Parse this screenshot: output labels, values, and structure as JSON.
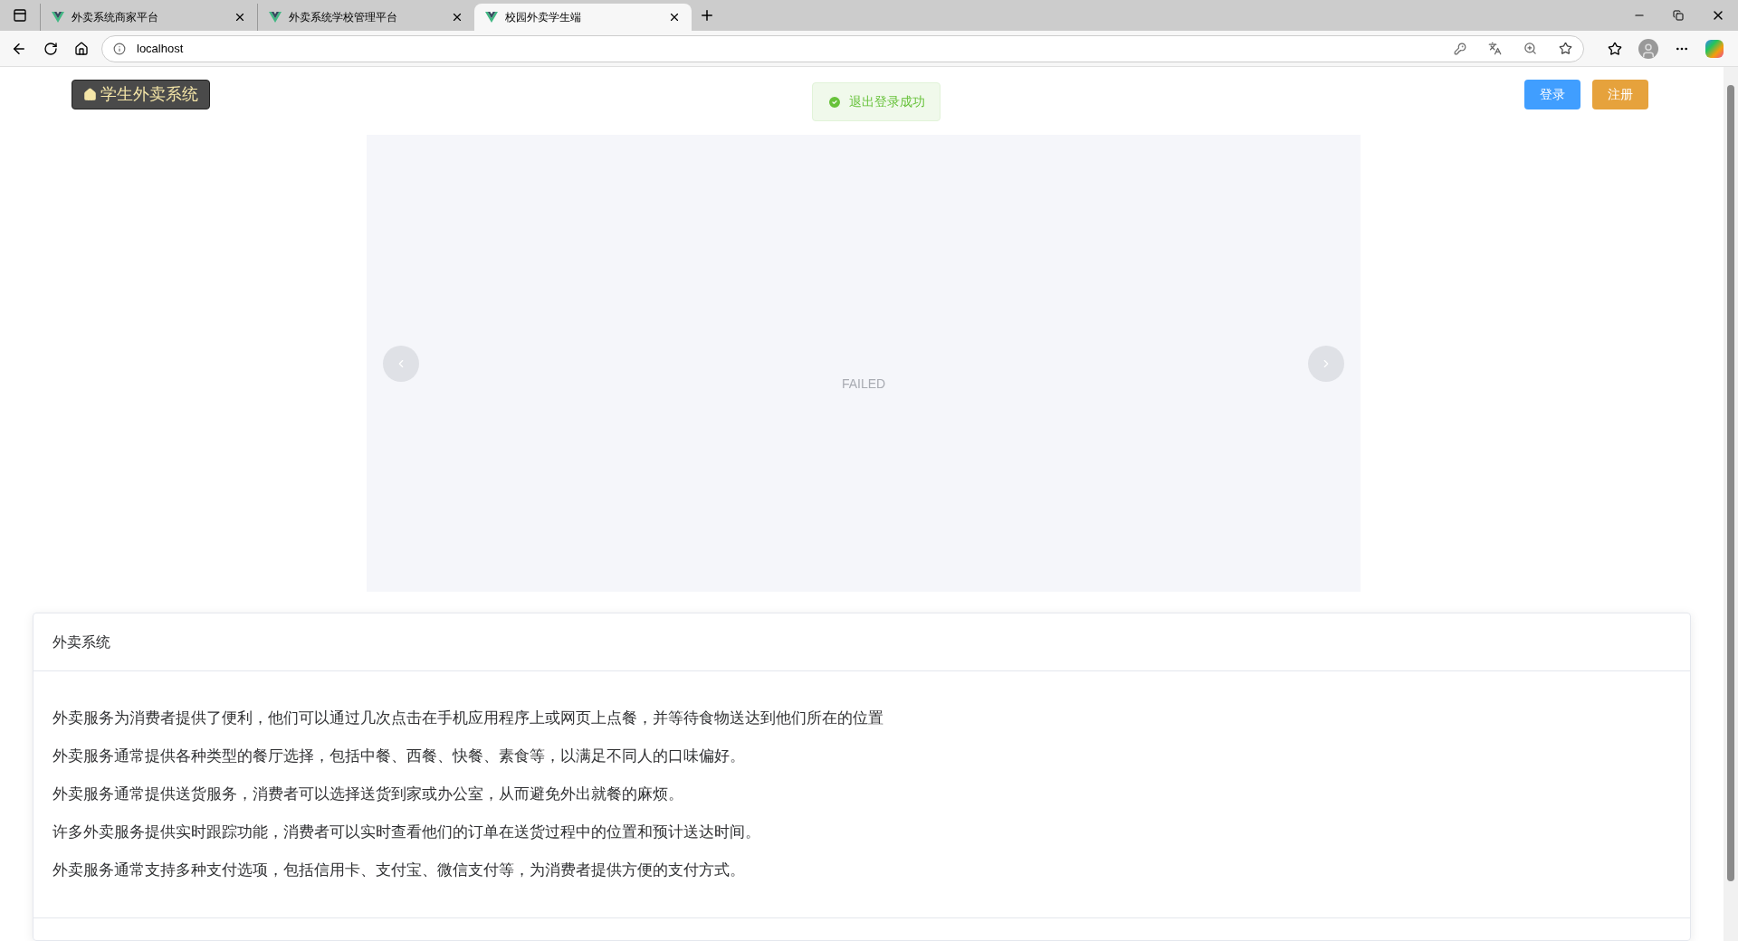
{
  "browser": {
    "tabs": [
      {
        "title": "外卖系统商家平台",
        "selected": false
      },
      {
        "title": "外卖系统学校管理平台",
        "selected": false
      },
      {
        "title": "校园外卖学生端",
        "selected": true
      }
    ],
    "address": "localhost"
  },
  "header": {
    "logo": "学生外卖系统",
    "toast": "退出登录成功",
    "buttons": [
      {
        "label": "登录",
        "kind": "primary"
      },
      {
        "label": "注册",
        "kind": "warning"
      }
    ]
  },
  "carousel": {
    "message": "FAILED"
  },
  "card": {
    "title": "外卖系统",
    "paragraphs": [
      "外卖服务为消费者提供了便利，他们可以通过几次点击在手机应用程序上或网页上点餐，并等待食物送达到他们所在的位置",
      "外卖服务通常提供各种类型的餐厅选择，包括中餐、西餐、快餐、素食等，以满足不同人的口味偏好。",
      "外卖服务通常提供送货服务，消费者可以选择送货到家或办公室，从而避免外出就餐的麻烦。",
      "许多外卖服务提供实时跟踪功能，消费者可以实时查看他们的订单在送货过程中的位置和预计送达时间。",
      "外卖服务通常支持多种支付选项，包括信用卡、支付宝、微信支付等，为消费者提供方便的支付方式。"
    ]
  }
}
